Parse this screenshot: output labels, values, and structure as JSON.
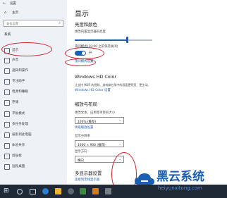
{
  "sidebar": {
    "title": "设置",
    "back_icon": "back-arrow-icon",
    "home": "主页",
    "search_placeholder": "查找设置",
    "section": "系统",
    "items": [
      {
        "label": "显示",
        "icon": "monitor-icon"
      },
      {
        "label": "声音",
        "icon": "speaker-icon"
      },
      {
        "label": "通知和操作",
        "icon": "notification-icon"
      },
      {
        "label": "专注助手",
        "icon": "moon-icon"
      },
      {
        "label": "电源和睡眠",
        "icon": "power-icon"
      },
      {
        "label": "存储",
        "icon": "storage-icon"
      },
      {
        "label": "平板模式",
        "icon": "tablet-icon"
      },
      {
        "label": "多任务处理",
        "icon": "multitask-icon"
      },
      {
        "label": "投影到此电脑",
        "icon": "project-icon"
      },
      {
        "label": "体验共享",
        "icon": "share-icon"
      },
      {
        "label": "剪贴板",
        "icon": "clipboard-icon"
      },
      {
        "label": "远程桌面",
        "icon": "remote-icon"
      }
    ]
  },
  "main": {
    "title": "显示",
    "brightness": {
      "heading": "亮度和颜色",
      "slider_label": "更改内置显示器的亮度",
      "level": 0.68,
      "night_light_label": "夜间模式(19:00 之前保持关闭)",
      "toggle_state": "开",
      "night_light_link": "夜间模式设置"
    },
    "hdr": {
      "heading": "Windows HD Color",
      "desc": "让支持 HDR 的视频、游戏和应用中的画面更明亮、更生动。",
      "link": "Windows HD Color 设置"
    },
    "scale": {
      "heading": "缩放与布局",
      "text_size_label": "更改文本、应用等项目的大小",
      "text_size_value": "100% (推荐)",
      "advanced_link": "高级缩放设置",
      "resolution_label": "显示分辨率",
      "resolution_value": "1600 × 900 (推荐)",
      "orientation_label": "显示方向",
      "orientation_value": "横向"
    },
    "multi": {
      "heading": "多显示器设置",
      "link": "连接到无线显示器"
    }
  },
  "watermark": {
    "text": "黑云系统",
    "url": "heiyunxitong.com"
  },
  "colors": {
    "accent": "#1a5fb4",
    "annotation": "#d4202c",
    "taskbar": "#1f2a36"
  }
}
